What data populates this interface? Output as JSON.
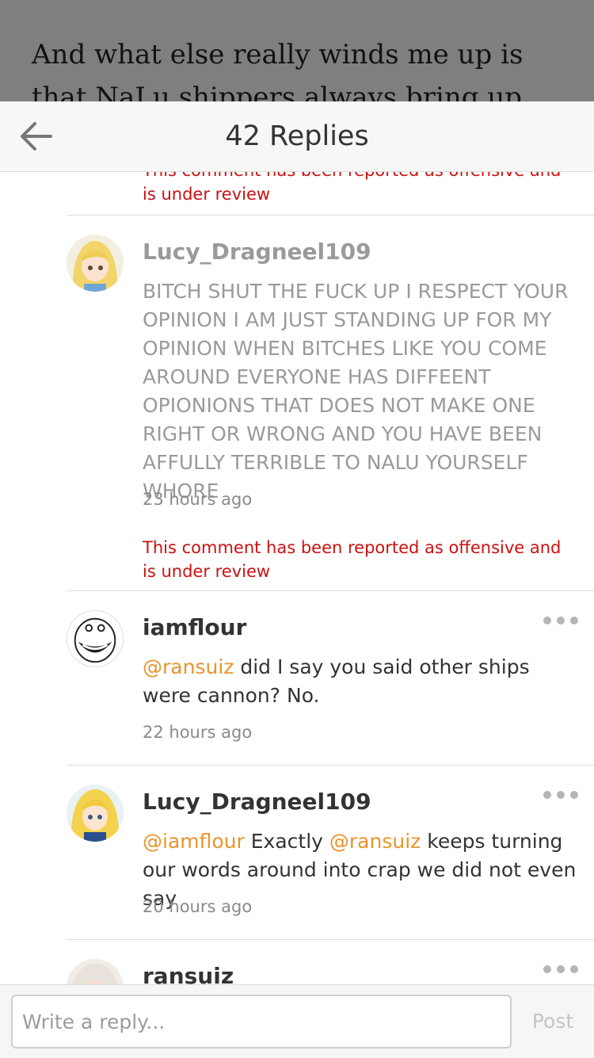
{
  "background_story": {
    "text": "And what else really winds me up is that NaLu shippers always bring up that it's"
  },
  "header": {
    "back_icon": "arrow-left-icon",
    "title": "42 Replies"
  },
  "notices": {
    "reported_text": "This comment has been reported as offensive and is under review",
    "partial_text": "under review"
  },
  "comments": [
    {
      "author": "Lucy_Dragneel109",
      "body": "BITCH SHUT THE FUCK UP I RESPECT YOUR OPINION I AM JUST STANDING UP FOR MY OPINION WHEN BITCHES LIKE YOU COME AROUND EVERYONE HAS DIFFEENT OPIONIONS THAT DOES NOT MAKE ONE RIGHT OR WRONG AND YOU HAVE BEEN AFFULLY TERRIBLE TO NALU YOURSELF WHORE",
      "time": "23 hours ago",
      "state": "reported"
    },
    {
      "author": "iamflour",
      "mention1": "@ransuiz",
      "body": " did I say you said other ships were cannon? No.",
      "time": "22 hours ago"
    },
    {
      "author": "Lucy_Dragneel109",
      "mention1": "@iamflour",
      "body_a": " Exactly ",
      "mention2": "@ransuiz",
      "body_b": " keeps turning our words around into crap we did not even say",
      "time": "20 hours ago"
    },
    {
      "author": "ransuiz"
    }
  ],
  "reply": {
    "placeholder": "Write a reply...",
    "post_label": "Post"
  },
  "colors": {
    "reported": "#cc1111",
    "mention": "#e8952b",
    "muted_text": "#9a9a9a"
  }
}
